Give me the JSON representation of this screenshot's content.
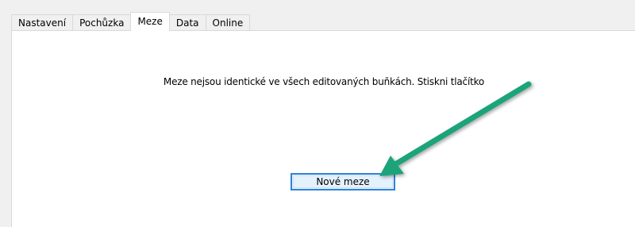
{
  "tabs": [
    {
      "label": "Nastavení",
      "active": false
    },
    {
      "label": "Pochůzka",
      "active": false
    },
    {
      "label": "Meze",
      "active": true
    },
    {
      "label": "Data",
      "active": false
    },
    {
      "label": "Online",
      "active": false
    }
  ],
  "content": {
    "message": "Meze nejsou identické ve všech editovaných buňkách. Stiskni tlačítko",
    "new_bounds_button": "Nové meze"
  },
  "annotation": {
    "arrow_color": "#1aa37a",
    "icon": "arrow-annotation-icon"
  },
  "colors": {
    "button_border": "#2f82d8",
    "button_fill": "#e5f1fb",
    "tab_border": "#d9d9d9"
  }
}
